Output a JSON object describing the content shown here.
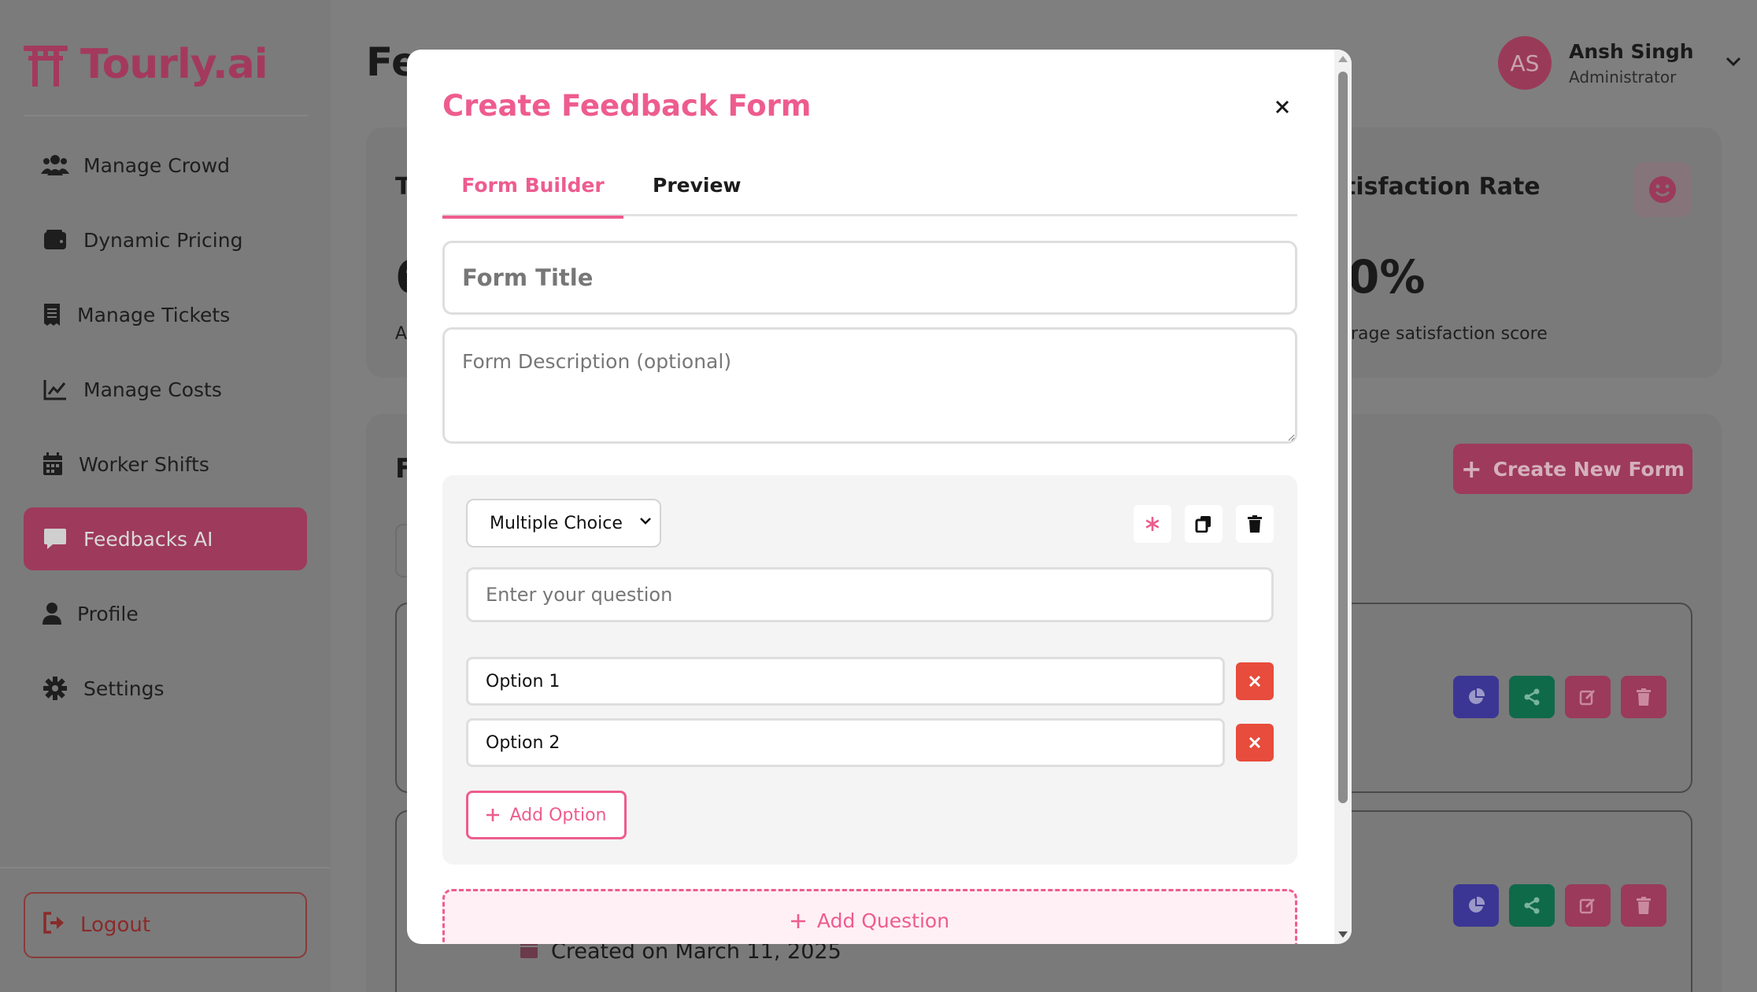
{
  "app": {
    "name": "Tourly.ai",
    "brand_color": "#ee5c8f"
  },
  "sidebar": {
    "items": [
      {
        "label": "Manage Crowd",
        "icon": "users-icon"
      },
      {
        "label": "Dynamic Pricing",
        "icon": "wallet-icon"
      },
      {
        "label": "Manage Tickets",
        "icon": "receipt-icon"
      },
      {
        "label": "Manage Costs",
        "icon": "chart-line-icon"
      },
      {
        "label": "Worker Shifts",
        "icon": "calendar-icon"
      },
      {
        "label": "Feedbacks AI",
        "icon": "comment-icon",
        "active": true
      },
      {
        "label": "Profile",
        "icon": "user-icon"
      },
      {
        "label": "Settings",
        "icon": "gear-icon"
      }
    ],
    "logout_label": "Logout"
  },
  "header": {
    "title_partial": "Fe",
    "user": {
      "initials": "AS",
      "name": "Ansh Singh",
      "role": "Administrator"
    }
  },
  "stats": {
    "left": {
      "title_partial": "T",
      "value_partial": "6",
      "sub_partial": "A"
    },
    "right": {
      "title_partial": "tisfaction Rate",
      "value_partial": "0%",
      "sub_partial": "rage satisfaction score"
    }
  },
  "forms_section": {
    "title_partial": "F",
    "create_button_label": "Create New Form",
    "created_text": "Created on March 11, 2025"
  },
  "modal": {
    "title": "Create Feedback Form",
    "tabs": [
      {
        "label": "Form Builder",
        "active": true
      },
      {
        "label": "Preview",
        "active": false
      }
    ],
    "form_title_placeholder": "Form Title",
    "form_description_placeholder": "Form Description (optional)",
    "question": {
      "type_selected": "Multiple Choice",
      "question_placeholder": "Enter your question",
      "options": [
        "Option 1",
        "Option 2"
      ],
      "add_option_label": "Add Option"
    },
    "add_question_label": "Add Question"
  }
}
